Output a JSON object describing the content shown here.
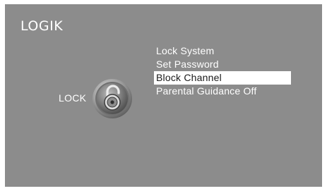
{
  "brand": {
    "logo_text": "LOGIK"
  },
  "section": {
    "label": "LOCK",
    "icon": "padlock-icon"
  },
  "menu": {
    "selected_index": 2,
    "items": [
      {
        "label": "Lock System"
      },
      {
        "label": "Set Password"
      },
      {
        "label": "Block Channel"
      },
      {
        "label": "Parental Guidance Off"
      }
    ]
  },
  "colors": {
    "background": "#8c8c8c",
    "text": "#ffffff",
    "highlight": "#ffffff",
    "highlight_text": "#1a1a1a"
  }
}
